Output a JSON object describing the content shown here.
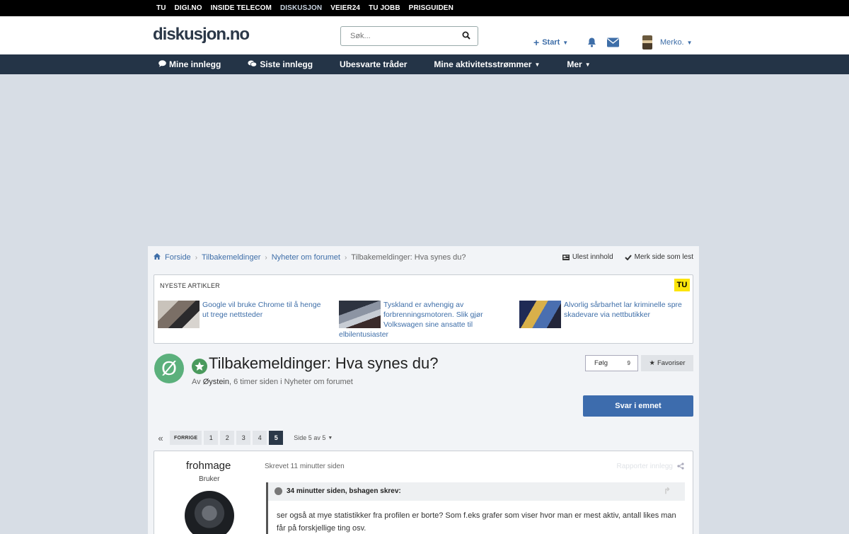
{
  "topbar": [
    "TU",
    "DIGI.NO",
    "INSIDE TELECOM",
    "DISKUSJON",
    "VEIER24",
    "TU JOBB",
    "PRISGUIDEN"
  ],
  "header": {
    "logo": "diskusjon.no",
    "search_placeholder": "Søk...",
    "start_label": "Start",
    "user_label": "Merko."
  },
  "nav": [
    "Mine innlegg",
    "Siste innlegg",
    "Ubesvarte tråder",
    "Mine aktivitetsstrømmer",
    "Mer"
  ],
  "breadcrumbs": [
    "Forside",
    "Tilbakemeldinger",
    "Nyheter om forumet",
    "Tilbakemeldinger: Hva synes du?"
  ],
  "crumb_actions": {
    "unread": "Ulest innhold",
    "mark_read": "Merk side som lest"
  },
  "articles": {
    "title": "NYESTE ARTIKLER",
    "brand": "TU",
    "items": [
      "Google vil bruke Chrome til å henge ut trege nettsteder",
      "Tyskland er avhengig av forbrenningsmotoren. Slik gjør Volkswagen sine ansatte til elbilentusiaster",
      "Alvorlig sårbarhet lar kriminelle spre skadevare via nettbutikker"
    ]
  },
  "topic": {
    "avatar_letter": "Ø",
    "title": "Tilbakemeldinger: Hva synes du?",
    "by": "Av",
    "author": "Øystein",
    "meta_rest": ", 6 timer siden i Nyheter om forumet",
    "follow_label": "Følg",
    "follow_count": "9",
    "favorite_label": "Favoriser",
    "reply_label": "Svar i emnet"
  },
  "pager": {
    "first": "«",
    "prev": "FORRIGE",
    "pages": [
      "1",
      "2",
      "3",
      "4",
      "5"
    ],
    "current": "5",
    "page_of": "Side 5 av 5"
  },
  "post": {
    "username": "frohmage",
    "role": "Bruker",
    "posted": "Skrevet 11 minutter siden",
    "report": "Rapporter innlegg",
    "quote_header": "34 minutter siden, bshagen skrev:",
    "quote_text": "ser også at mye statistikker fra profilen er borte? Som f.eks grafer som viser hvor man er mest aktiv, antall likes man får på forskjellige ting osv."
  },
  "colors": {
    "accent": "#3d6cad",
    "nav": "#243447",
    "link": "#3e6ea8",
    "avatar_green": "#5bb07c"
  }
}
